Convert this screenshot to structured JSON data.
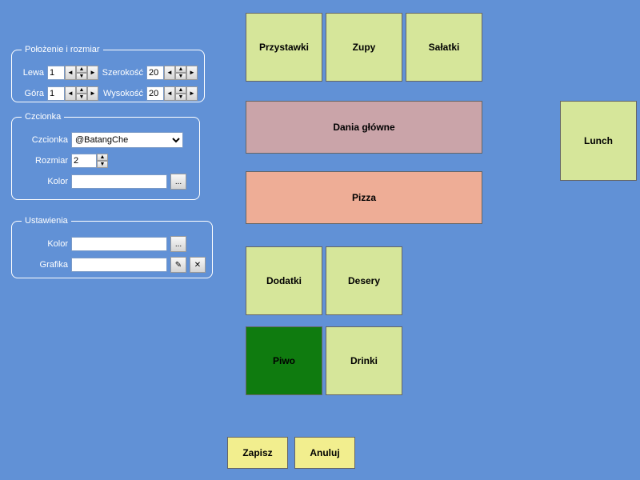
{
  "panels": {
    "position": {
      "legend": "Położenie i rozmiar",
      "left_label": "Lewa",
      "left_value": "1",
      "width_label": "Szerokość",
      "width_value": "20",
      "top_label": "Góra",
      "top_value": "1",
      "height_label": "Wysokość",
      "height_value": "20"
    },
    "font": {
      "legend": "Czcionka",
      "font_label": "Czcionka",
      "font_value": "@BatangChe",
      "size_label": "Rozmiar",
      "size_value": "2",
      "color_label": "Kolor",
      "ellipsis": "..."
    },
    "settings": {
      "legend": "Ustawienia",
      "color_label": "Kolor",
      "ellipsis": "...",
      "graphic_label": "Grafika"
    }
  },
  "tiles": {
    "przystawki": "Przystawki",
    "zupy": "Zupy",
    "salatki": "Sałatki",
    "dania": "Dania główne",
    "pizza": "Pizza",
    "lunch": "Lunch",
    "dodatki": "Dodatki",
    "desery": "Desery",
    "piwo": "Piwo",
    "drinki": "Drinki"
  },
  "actions": {
    "save": "Zapisz",
    "cancel": "Anuluj"
  }
}
